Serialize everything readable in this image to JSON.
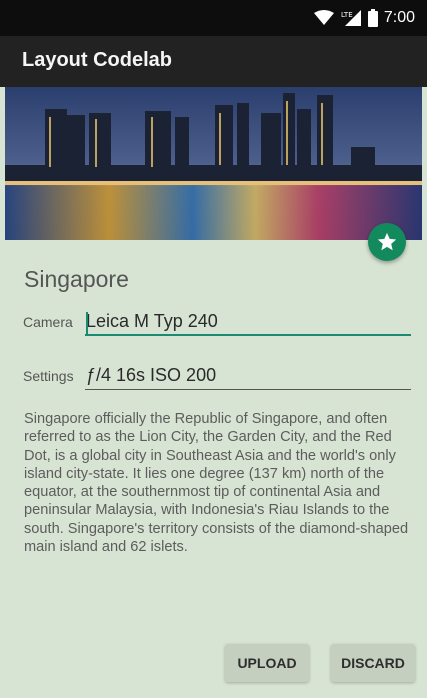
{
  "status_bar": {
    "time": "7:00",
    "network_label": "LTE",
    "icons": [
      "wifi-icon",
      "cell-signal-icon",
      "battery-icon"
    ]
  },
  "app_bar": {
    "title": "Layout Codelab"
  },
  "hero_image": {
    "subject": "city-skyline-photo"
  },
  "fab": {
    "icon": "star-icon",
    "color": "#138a5d"
  },
  "content": {
    "title": "Singapore",
    "camera": {
      "label": "Camera",
      "value": "Leica M Typ 240"
    },
    "settings": {
      "label": "Settings",
      "value": "ƒ/4 16s ISO 200"
    },
    "description": "Singapore officially the Republic of Singapore, and often referred to as the Lion City, the Garden City, and the Red Dot, is a global city in Southeast Asia and the world's only island city-state. It lies one degree (137 km) north of the equator, at the southernmost tip of continental Asia and peninsular Malaysia, with Indonesia's Riau Islands to the south. Singapore's territory consists of the diamond-shaped main island and 62 islets."
  },
  "actions": {
    "upload_label": "UPLOAD",
    "discard_label": "DISCARD"
  },
  "colors": {
    "accent": "#1a8a70",
    "background": "#d8e4d3",
    "app_bar": "#222222"
  }
}
